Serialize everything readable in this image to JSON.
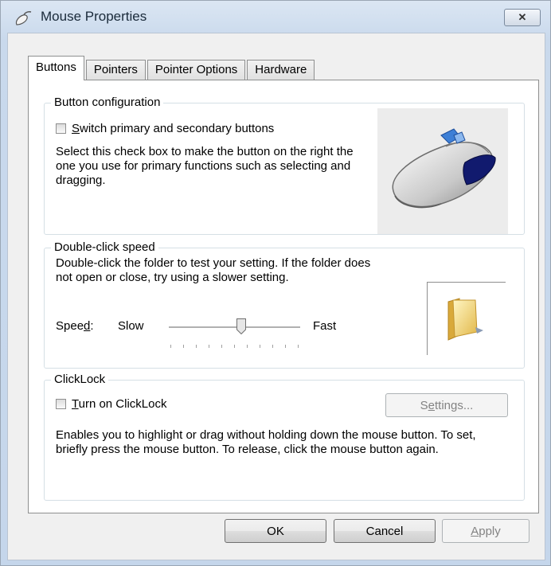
{
  "window": {
    "title": "Mouse Properties",
    "close_label": "✕"
  },
  "tabs": [
    {
      "label": "Buttons",
      "active": true
    },
    {
      "label": "Pointers",
      "active": false
    },
    {
      "label": "Pointer Options",
      "active": false
    },
    {
      "label": "Hardware",
      "active": false
    }
  ],
  "button_config": {
    "title": "Button configuration",
    "checkbox_label_first": "S",
    "checkbox_label_rest": "witch primary and secondary buttons",
    "checked": false,
    "description": "Select this check box to make the button on the right the one you use for primary functions such as selecting and dragging."
  },
  "double_click": {
    "title": "Double-click speed",
    "description": "Double-click the folder to test your setting. If the folder does not open or close, try using a slower setting.",
    "speed_label_pre": "Spee",
    "speed_label_ul": "d",
    "speed_label_post": ":",
    "slow_label": "Slow",
    "fast_label": "Fast",
    "speed_level": 0.55
  },
  "clicklock": {
    "title": "ClickLock",
    "checkbox_label_first": "T",
    "checkbox_label_rest": "urn on ClickLock",
    "checked": false,
    "settings_pre": "S",
    "settings_ul": "e",
    "settings_post": "ttings...",
    "description": "Enables you to highlight or drag without holding down the mouse button. To set, briefly press the mouse button. To release, click the mouse button again."
  },
  "footer": {
    "ok_label": "OK",
    "cancel_label": "Cancel",
    "apply_ul": "A",
    "apply_rest": "pply"
  },
  "icons": {
    "title": "mouse-title-icon",
    "mouse": "mouse-image",
    "folder": "folder-icon",
    "close": "close-icon"
  }
}
